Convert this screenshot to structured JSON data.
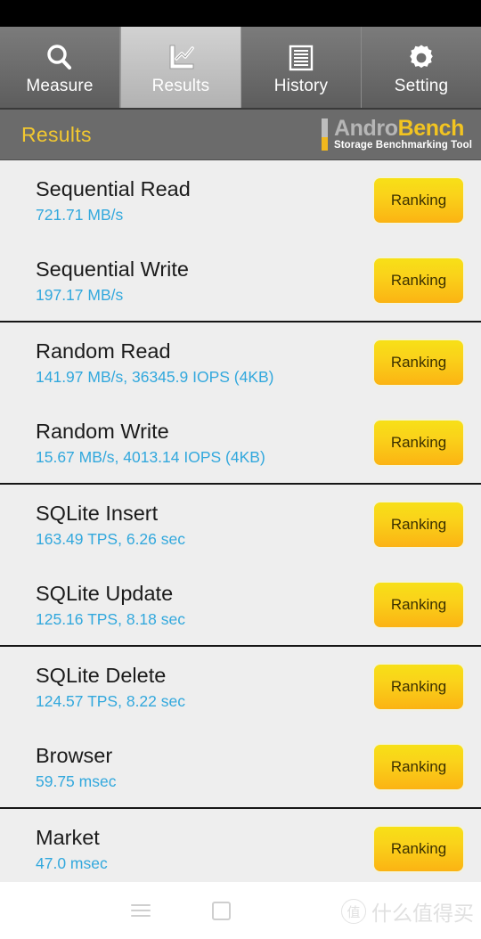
{
  "status_bar": {
    "color": "#000000"
  },
  "tabs": [
    {
      "label": "Measure",
      "icon": "search-icon",
      "active": false
    },
    {
      "label": "Results",
      "icon": "chart-icon",
      "active": true
    },
    {
      "label": "History",
      "icon": "list-lines-icon",
      "active": false
    },
    {
      "label": "Setting",
      "icon": "gear-icon",
      "active": false
    }
  ],
  "title_bar": {
    "title": "Results",
    "title_color": "#F2C830",
    "brand_part1": "Andro",
    "brand_part2": "Bench",
    "brand_tagline": "Storage Benchmarking Tool",
    "brand_color_1": "#B6B6B6",
    "brand_color_2": "#F2C421"
  },
  "colors": {
    "value_blue": "#32A8DD",
    "button_yellow_top": "#F7E017",
    "button_orange_bottom": "#FBB313",
    "list_background": "#EEEEEE",
    "divider": "#161616"
  },
  "results_groups": [
    {
      "rows": [
        {
          "name": "Sequential Read",
          "value": "721.71 MB/s",
          "button": "Ranking"
        },
        {
          "name": "Sequential Write",
          "value": "197.17 MB/s",
          "button": "Ranking"
        }
      ]
    },
    {
      "rows": [
        {
          "name": "Random Read",
          "value": "141.97 MB/s, 36345.9 IOPS (4KB)",
          "button": "Ranking"
        },
        {
          "name": "Random Write",
          "value": "15.67 MB/s, 4013.14 IOPS (4KB)",
          "button": "Ranking"
        }
      ]
    },
    {
      "rows": [
        {
          "name": "SQLite Insert",
          "value": "163.49 TPS, 6.26 sec",
          "button": "Ranking"
        },
        {
          "name": "SQLite Update",
          "value": "125.16 TPS, 8.18 sec",
          "button": "Ranking"
        }
      ]
    },
    {
      "rows": [
        {
          "name": "SQLite Delete",
          "value": "124.57 TPS, 8.22 sec",
          "button": "Ranking"
        },
        {
          "name": "Browser",
          "value": "59.75 msec",
          "button": "Ranking"
        }
      ]
    },
    {
      "rows": [
        {
          "name": "Market",
          "value": "47.0 msec",
          "button": "Ranking"
        }
      ]
    }
  ],
  "bottom_nav": {
    "menu_icon": "hamburger-menu-icon",
    "home_icon": "square-home-icon",
    "watermark_badge": "值",
    "watermark_text": "什么值得买"
  }
}
